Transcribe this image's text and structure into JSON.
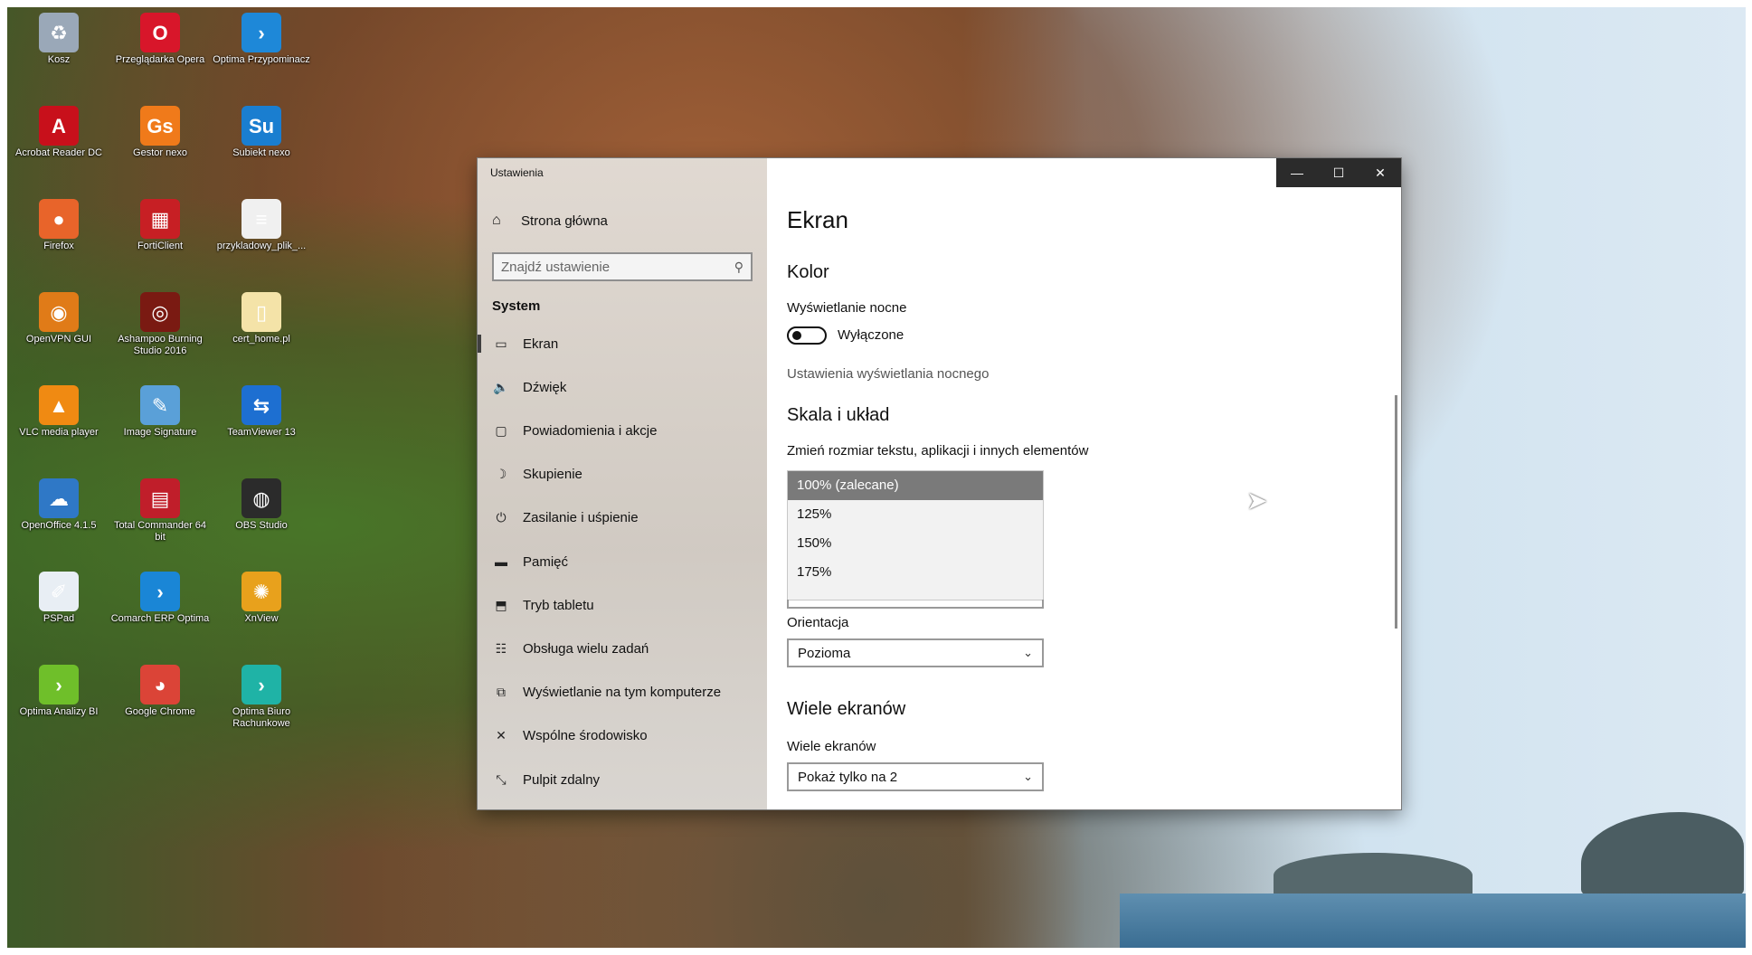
{
  "desktop": {
    "icons": [
      {
        "label": "Kosz",
        "icon": "recycle-bin-icon",
        "color": "#9aa8b8",
        "glyph": "♻"
      },
      {
        "label": "Przeglądarka Opera",
        "icon": "opera-icon",
        "color": "#d8162a",
        "glyph": "O"
      },
      {
        "label": "Optima Przypominacz",
        "icon": "optima-reminder-icon",
        "color": "#1e88d8",
        "glyph": "›"
      },
      {
        "label": "Acrobat Reader DC",
        "icon": "acrobat-icon",
        "color": "#c8101b",
        "glyph": "A"
      },
      {
        "label": "Gestor nexo",
        "icon": "gestor-icon",
        "color": "#f07a1a",
        "glyph": "Gs"
      },
      {
        "label": "Subiekt nexo",
        "icon": "subiekt-icon",
        "color": "#1a7ed0",
        "glyph": "Su"
      },
      {
        "label": "Firefox",
        "icon": "firefox-icon",
        "color": "#e8642a",
        "glyph": "●"
      },
      {
        "label": "FortiClient",
        "icon": "forticlient-icon",
        "color": "#c71f24",
        "glyph": "▦"
      },
      {
        "label": "przykladowy_plik_...",
        "icon": "text-file-icon",
        "color": "#f0f0f0",
        "glyph": "≡"
      },
      {
        "label": "OpenVPN GUI",
        "icon": "openvpn-icon",
        "color": "#e07b18",
        "glyph": "◉"
      },
      {
        "label": "Ashampoo Burning Studio 2016",
        "icon": "ashampoo-icon",
        "color": "#7a1a12",
        "glyph": "◎"
      },
      {
        "label": "cert_home.pl",
        "icon": "file-icon",
        "color": "#f4e3a8",
        "glyph": "▯"
      },
      {
        "label": "VLC media player",
        "icon": "vlc-icon",
        "color": "#f08a12",
        "glyph": "▲"
      },
      {
        "label": "Image Signature",
        "icon": "image-signature-icon",
        "color": "#5aa0d8",
        "glyph": "✎"
      },
      {
        "label": "TeamViewer 13",
        "icon": "teamviewer-icon",
        "color": "#1d6fd1",
        "glyph": "⇆"
      },
      {
        "label": "OpenOffice 4.1.5",
        "icon": "openoffice-icon",
        "color": "#2f78c6",
        "glyph": "☁"
      },
      {
        "label": "Total Commander 64 bit",
        "icon": "total-commander-icon",
        "color": "#c01e2a",
        "glyph": "▤"
      },
      {
        "label": "OBS Studio",
        "icon": "obs-icon",
        "color": "#2b2b2b",
        "glyph": "◍"
      },
      {
        "label": "PSPad",
        "icon": "pspad-icon",
        "color": "#e8eef4",
        "glyph": "✐"
      },
      {
        "label": "Comarch ERP Optima",
        "icon": "comarch-optima-icon",
        "color": "#1a86d6",
        "glyph": "›"
      },
      {
        "label": "XnView",
        "icon": "xnview-icon",
        "color": "#e8a11c",
        "glyph": "✺"
      },
      {
        "label": "Optima Analizy BI",
        "icon": "optima-bi-icon",
        "color": "#6fbf2a",
        "glyph": "›"
      },
      {
        "label": "Google Chrome",
        "icon": "chrome-icon",
        "color": "#db4437",
        "glyph": "◕"
      },
      {
        "label": "Optima Biuro Rachunkowe",
        "icon": "optima-biuro-icon",
        "color": "#1fb3a6",
        "glyph": "›"
      }
    ]
  },
  "window": {
    "title": "Ustawienia",
    "minimize": "—",
    "maximize": "☐",
    "close": "✕"
  },
  "sidebar": {
    "home": "Strona główna",
    "search_placeholder": "Znajdź ustawienie",
    "section": "System",
    "items": [
      {
        "label": "Ekran",
        "icon": "display-icon",
        "glyph": "▭"
      },
      {
        "label": "Dźwięk",
        "icon": "speaker-icon",
        "glyph": "🔈"
      },
      {
        "label": "Powiadomienia i akcje",
        "icon": "notifications-icon",
        "glyph": "▢"
      },
      {
        "label": "Skupienie",
        "icon": "moon-icon",
        "glyph": "☽"
      },
      {
        "label": "Zasilanie i uśpienie",
        "icon": "power-icon",
        "glyph": "⏻"
      },
      {
        "label": "Pamięć",
        "icon": "storage-icon",
        "glyph": "▬"
      },
      {
        "label": "Tryb tabletu",
        "icon": "tablet-icon",
        "glyph": "⬒"
      },
      {
        "label": "Obsługa wielu zadań",
        "icon": "multitasking-icon",
        "glyph": "☷"
      },
      {
        "label": "Wyświetlanie na tym komputerze",
        "icon": "project-icon",
        "glyph": "⧉"
      },
      {
        "label": "Wspólne środowisko",
        "icon": "shared-icon",
        "glyph": "✕"
      },
      {
        "label": "Pulpit zdalny",
        "icon": "remote-desktop-icon",
        "glyph": "⤡"
      }
    ]
  },
  "content": {
    "title": "Ekran",
    "color_heading": "Kolor",
    "night_light_label": "Wyświetlanie nocne",
    "night_light_state": "Wyłączone",
    "night_light_link": "Ustawienia wyświetlania nocnego",
    "scale_heading": "Skala i układ",
    "scale_label": "Zmień rozmiar tekstu, aplikacji i innych elementów",
    "scale_options": [
      "100% (zalecane)",
      "125%",
      "150%",
      "175%"
    ],
    "orientation_label": "Orientacja",
    "orientation_value": "Pozioma",
    "multi_heading": "Wiele ekranów",
    "multi_label": "Wiele ekranów",
    "multi_value": "Pokaż tylko na 2"
  }
}
